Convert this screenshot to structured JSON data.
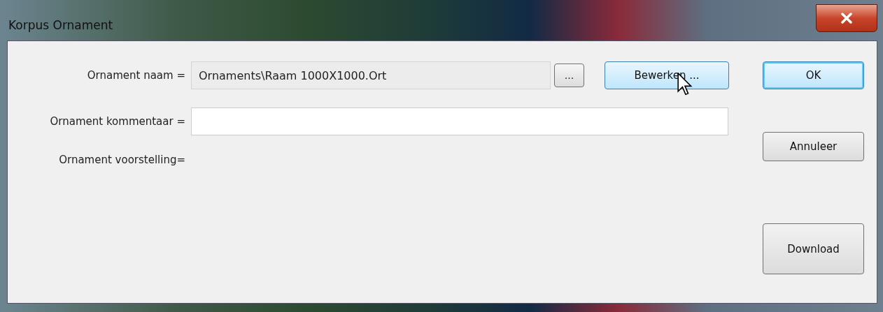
{
  "window": {
    "title": "Korpus Ornament"
  },
  "fields": [
    {
      "kind": "readonly",
      "label": "Ornament naam =",
      "value": "Ornaments\\Raam 1000X1000.Ort"
    },
    {
      "kind": "text",
      "label": "Ornament kommentaar ="
    }
  ],
  "browse_button": {
    "label": "..."
  },
  "edit_button": {
    "label": "Bewerken ...",
    "hovered": true
  },
  "preview_label": "Ornament voorstelling=",
  "buttons": [
    {
      "label": "OK",
      "default": true
    },
    {
      "label": "Annuleer",
      "default": false
    },
    {
      "label": "Download",
      "default": false
    }
  ]
}
